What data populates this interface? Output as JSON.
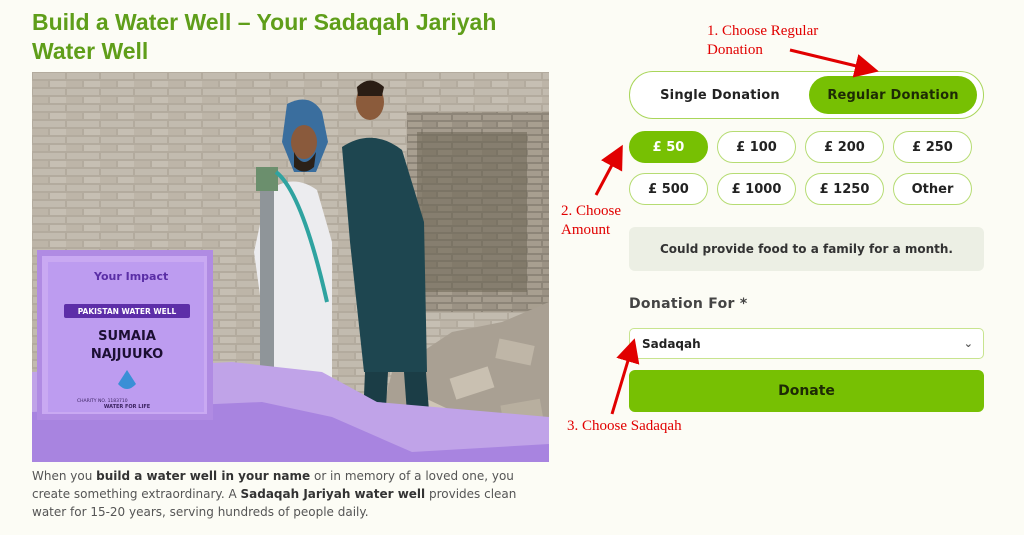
{
  "title": "Build a Water Well – Your Sadaqah Jariyah Water Well",
  "photo": {
    "sign_brand": "Your Impact",
    "sign_banner": "PAKISTAN WATER WELL",
    "sign_name_line1": "SUMAIA",
    "sign_name_line2": "NAJJUUKO",
    "sign_charity": "CHARITY NO. 1183710",
    "sign_logo_caption": "WATER FOR LIFE"
  },
  "description": {
    "part1": "When you ",
    "bold1": "build a water well in your name",
    "part2": " or in memory of a loved one, you create something extraordinary. A ",
    "bold2": "Sadaqah Jariyah water well",
    "part3": " provides clean water for 15-20 years, serving hundreds of people daily."
  },
  "donation_type": {
    "single": "Single Donation",
    "regular": "Regular Donation",
    "selected": "Regular Donation"
  },
  "amounts": [
    "£ 50",
    "£ 100",
    "£ 200",
    "£ 250",
    "£ 500",
    "£ 1000",
    "£ 1250",
    "Other"
  ],
  "selected_amount": "£ 50",
  "impact_text": "Could provide food to a family for a month.",
  "donation_for": {
    "label": "Donation For *",
    "value": "Sadaqah"
  },
  "donate_label": "Donate",
  "annotations": {
    "step1_line1": "1. Choose Regular",
    "step1_line2": "Donation",
    "step2_line1": "2. Choose",
    "step2_line2": "Amount",
    "step3": "3. Choose Sadaqah"
  },
  "colors": {
    "accent": "#77c003",
    "title": "#5f9e1a",
    "annotation": "#e10000"
  }
}
